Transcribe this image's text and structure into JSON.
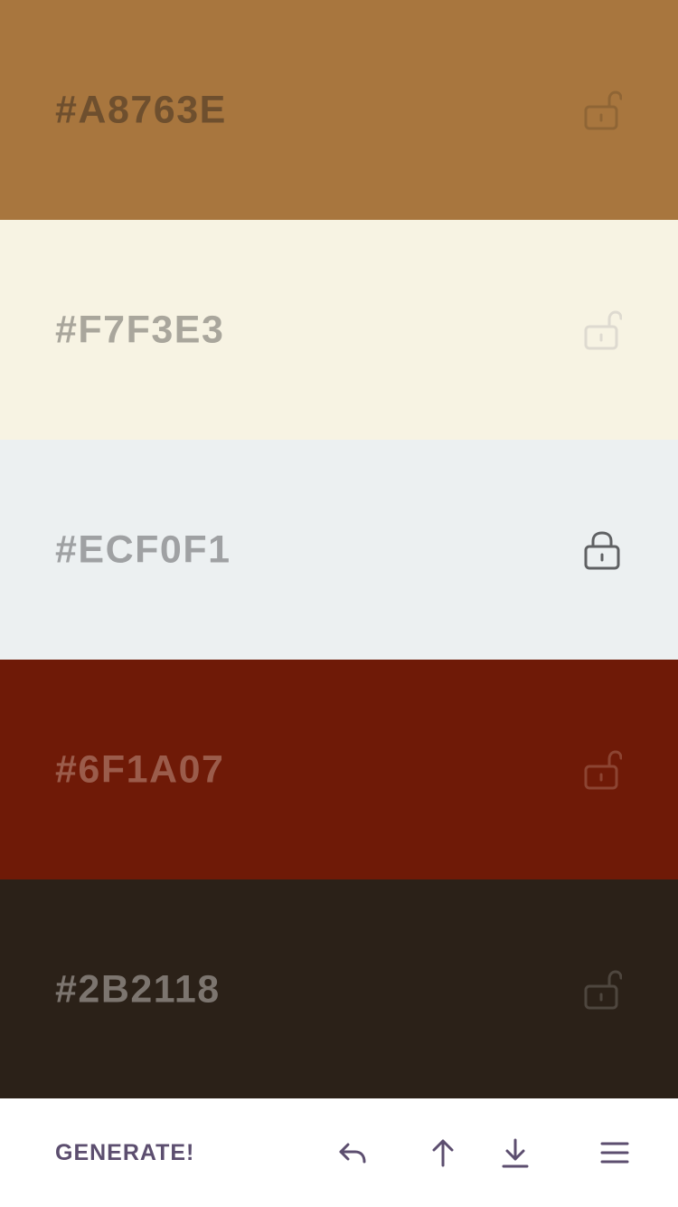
{
  "swatches": [
    {
      "hex": "#A8763E",
      "bg": "#A8763E",
      "text_color": "#6e4f2e",
      "locked": false,
      "lock_color": "#8f6535"
    },
    {
      "hex": "#F7F3E3",
      "bg": "#F7F3E3",
      "text_color": "#a9a69c",
      "locked": false,
      "lock_color": "#dedad0"
    },
    {
      "hex": "#ECF0F1",
      "bg": "#ECF0F1",
      "text_color": "#9fa1a3",
      "locked": true,
      "lock_color": "#5f6163"
    },
    {
      "hex": "#6F1A07",
      "bg": "#6F1A07",
      "text_color": "#9b5c4b",
      "locked": false,
      "lock_color": "#8c4432"
    },
    {
      "hex": "#2B2118",
      "bg": "#2B2118",
      "text_color": "#7c756f",
      "locked": false,
      "lock_color": "#4e463e"
    }
  ],
  "toolbar": {
    "generate_label": "GENERATE!",
    "accent_color": "#5c4e6f",
    "icons": [
      "undo-icon",
      "arrow-up-icon",
      "download-icon",
      "menu-icon"
    ]
  }
}
